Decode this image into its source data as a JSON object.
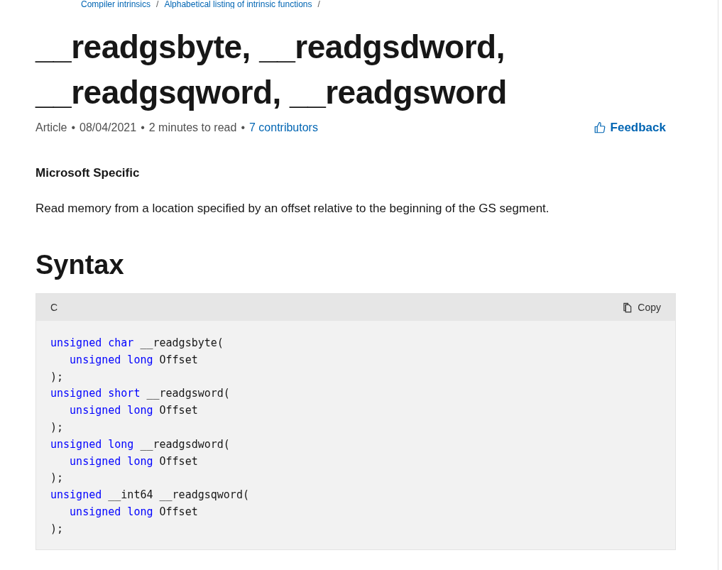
{
  "breadcrumbs": [
    {
      "label": "Compiler intrinsics",
      "separator": "/"
    },
    {
      "label": "Alphabetical listing of intrinsic functions",
      "separator": "/"
    }
  ],
  "title": "__readgsbyte, __readgsdword, __readgsqword, __readgsword",
  "meta": {
    "type": "Article",
    "date": "08/04/2021",
    "read_time": "2 minutes to read",
    "contributors": "7 contributors",
    "separator": "•"
  },
  "feedback": "Feedback",
  "specific": "Microsoft Specific",
  "description": "Read memory from a location specified by an offset relative to the beginning of the GS segment.",
  "section_heading": "Syntax",
  "code": {
    "language": "C",
    "copy": "Copy",
    "lines": [
      {
        "indent": false,
        "tokens": [
          {
            "text": "unsigned char",
            "kind": "keyword"
          },
          {
            "text": " __readgsbyte(",
            "kind": "plain"
          }
        ]
      },
      {
        "indent": true,
        "tokens": [
          {
            "text": "unsigned long",
            "kind": "keyword"
          },
          {
            "text": " Offset",
            "kind": "plain"
          }
        ]
      },
      {
        "indent": false,
        "tokens": [
          {
            "text": ");",
            "kind": "plain"
          }
        ]
      },
      {
        "indent": false,
        "tokens": [
          {
            "text": "unsigned short",
            "kind": "keyword"
          },
          {
            "text": " __readgsword(",
            "kind": "plain"
          }
        ]
      },
      {
        "indent": true,
        "tokens": [
          {
            "text": "unsigned long",
            "kind": "keyword"
          },
          {
            "text": " Offset",
            "kind": "plain"
          }
        ]
      },
      {
        "indent": false,
        "tokens": [
          {
            "text": ");",
            "kind": "plain"
          }
        ]
      },
      {
        "indent": false,
        "tokens": [
          {
            "text": "unsigned long",
            "kind": "keyword"
          },
          {
            "text": " __readgsdword(",
            "kind": "plain"
          }
        ]
      },
      {
        "indent": true,
        "tokens": [
          {
            "text": "unsigned long",
            "kind": "keyword"
          },
          {
            "text": " Offset",
            "kind": "plain"
          }
        ]
      },
      {
        "indent": false,
        "tokens": [
          {
            "text": ");",
            "kind": "plain"
          }
        ]
      },
      {
        "indent": false,
        "tokens": [
          {
            "text": "unsigned",
            "kind": "keyword"
          },
          {
            "text": " __int64 __readgsqword(",
            "kind": "plain"
          }
        ]
      },
      {
        "indent": true,
        "tokens": [
          {
            "text": "unsigned long",
            "kind": "keyword"
          },
          {
            "text": " Offset",
            "kind": "plain"
          }
        ]
      },
      {
        "indent": false,
        "tokens": [
          {
            "text": ");",
            "kind": "plain"
          }
        ]
      }
    ]
  }
}
